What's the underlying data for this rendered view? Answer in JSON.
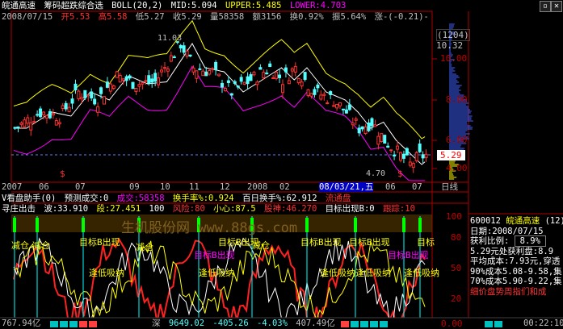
{
  "header": {
    "stock_name": "皖通高速",
    "indicator1": "筹码超跌综合选",
    "boll": "BOLL(20,2)",
    "mid": "MID:5.094",
    "upper": "UPPER:5.485",
    "lower": "LOWER:4.703"
  },
  "quote_line": {
    "date": "2008/07/15",
    "open": "开5.53",
    "high": "高5.58",
    "low": "低5.27",
    "close": "收5.29",
    "volume": "量58358",
    "amount": "额3156",
    "turnover": "换0.92%",
    "amplitude": "振5.64%",
    "change": "涨-(-0.21)-"
  },
  "price_axis": {
    "code_box": "(1204)",
    "current": "10.32",
    "ticks": [
      "10.00",
      "8.00",
      "6.00",
      "4.00"
    ],
    "price_tag": "5.29",
    "high_label": "11.03",
    "low_label": "4.70"
  },
  "date_axis": {
    "labels": [
      "2007",
      "06",
      "07",
      "09",
      "10",
      "11",
      "12",
      "2008",
      "02",
      "08/03/21,五",
      "06",
      "07"
    ],
    "tab": "日线"
  },
  "assist_line": {
    "name": "V看盘助手(0)",
    "predict": "预测成交:0",
    "vol": "成交:58358",
    "turn": "换手率%:0.924",
    "hundred": "百日换手%:62.912",
    "float": "流通盘"
  },
  "xunzhuang_line": {
    "name": "寻庄出击",
    "wave": "波:33.910",
    "duan": "段:27.451",
    "v100": "100",
    "risk": "风险:80",
    "careful": "小心:87.5",
    "stock_god": "股神:46.270",
    "target": "目标出现B:0",
    "track": "跟踪:10"
  },
  "watermark": "生机股份网 www.88gs.com",
  "lower_axis": {
    "ticks": [
      "100",
      "80",
      "50",
      "20",
      "0.00"
    ]
  },
  "chart_labels": [
    {
      "text": "减仓"
    },
    {
      "text": "减仓"
    },
    {
      "text": "目标B出现"
    },
    {
      "text": "目标B出现"
    },
    {
      "text": "减仓"
    },
    {
      "text": "目标B出现"
    },
    {
      "text": "减仓"
    },
    {
      "text": "目标B出现"
    },
    {
      "text": "目标B出现"
    },
    {
      "text": "逢低吸纳"
    },
    {
      "text": "逢低吸纳"
    },
    {
      "text": "逢低吸纳"
    },
    {
      "text": "逢低吸纳"
    },
    {
      "text": "目标B出现"
    },
    {
      "text": "逢低吸纳"
    },
    {
      "text": "目标"
    },
    {
      "text": "逢低吸纳"
    }
  ],
  "side_panel": {
    "code": "600012",
    "name": "皖通高速",
    "count": "(12)",
    "date": "日期:2008/07/15",
    "profit_label": "获利比例:",
    "profit_value": "8.9%",
    "profit_line": "5.29元处获利盘:8.9",
    "avg_cost": "平均成本:7.93元,穿透",
    "range90": "90%成本5.08-9.58,集",
    "range70": "70%成本5.90-9.22,集",
    "note": "细价盘势周指们和成"
  },
  "status_bar": {
    "left_value": "767.94亿",
    "index_name": "深",
    "index_value": "9649.02",
    "index_change": "-405.26",
    "index_pct": "-4.03%",
    "index_amount": "407.49亿",
    "time": "00:22:10"
  },
  "colors": {
    "up": "#ff3232",
    "down": "#54ffff",
    "yellow": "#ffff00",
    "white": "#ffffff",
    "magenta": "#ff00ff",
    "green": "#00ff00",
    "axis": "#b00000"
  },
  "icons": {
    "minimize": "minimize-icon",
    "close": "close-icon"
  }
}
